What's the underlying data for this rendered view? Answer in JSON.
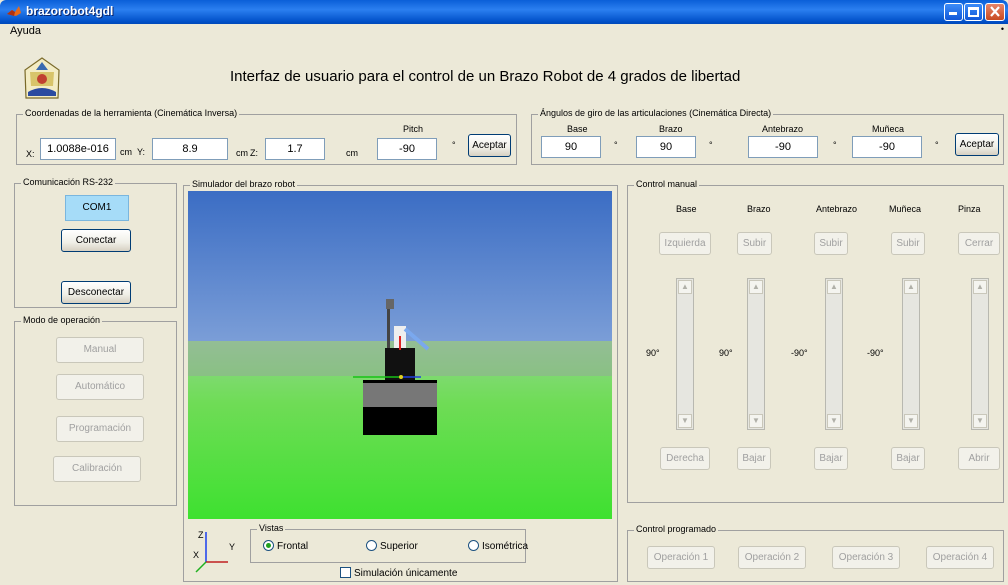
{
  "window": {
    "title": "brazorobot4gdl"
  },
  "menu": {
    "help": "Ayuda",
    "dot": "•"
  },
  "header": {
    "title": "Interfaz de usuario para el control de un Brazo Robot de 4 grados de libertad"
  },
  "inverse": {
    "legend": "Coordenadas de la herramienta (Cinemática Inversa)",
    "x_label": "X:",
    "x_value": "1.0088e-016",
    "x_unit": "cm",
    "y_label": "Y:",
    "y_value": "8.9",
    "y_unit": "cm",
    "z_label": "Z:",
    "z_value": "1.7",
    "z_unit": "cm",
    "pitch_label": "Pitch",
    "pitch_value": "-90",
    "pitch_unit": "°",
    "accept": "Aceptar"
  },
  "direct": {
    "legend": "Ángulos de giro de las articulaciones (Cinemática Directa)",
    "base_label": "Base",
    "base_value": "90",
    "brazo_label": "Brazo",
    "brazo_value": "90",
    "antebrazo_label": "Antebrazo",
    "antebrazo_value": "-90",
    "muneca_label": "Muñeca",
    "muneca_value": "-90",
    "deg": "°",
    "accept": "Aceptar"
  },
  "comm": {
    "legend": "Comunicación RS-232",
    "port": "COM1",
    "connect": "Conectar",
    "disconnect": "Desconectar"
  },
  "mode": {
    "legend": "Modo de operación",
    "manual": "Manual",
    "auto": "Automático",
    "program": "Programación",
    "calib": "Calibración"
  },
  "sim": {
    "legend": "Simulador del brazo robot",
    "axes": {
      "z": "Z",
      "y": "Y",
      "x": "X"
    }
  },
  "views": {
    "legend": "Vistas",
    "frontal": "Frontal",
    "superior": "Superior",
    "isometric": "Isométrica",
    "selected": "Frontal",
    "sim_only": "Simulación únicamente"
  },
  "manual_ctrl": {
    "legend": "Control manual",
    "headers": [
      "Base",
      "Brazo",
      "Antebrazo",
      "Muñeca",
      "Pinza"
    ],
    "top_buttons": [
      "Izquierda",
      "Subir",
      "Subir",
      "Subir",
      "Cerrar"
    ],
    "bottom_buttons": [
      "Derecha",
      "Bajar",
      "Bajar",
      "Bajar",
      "Abrir"
    ],
    "values": [
      "90°",
      "90°",
      "-90°",
      "-90°"
    ]
  },
  "program_ctrl": {
    "legend": "Control programado",
    "ops": [
      "Operación 1",
      "Operación 2",
      "Operación 3",
      "Operación 4"
    ]
  },
  "colors": {
    "titlebar": "#0a5fd8",
    "com_button": "#a6dcf8",
    "sky_top": "#3b6dc4",
    "ground": "#5edb4a"
  }
}
